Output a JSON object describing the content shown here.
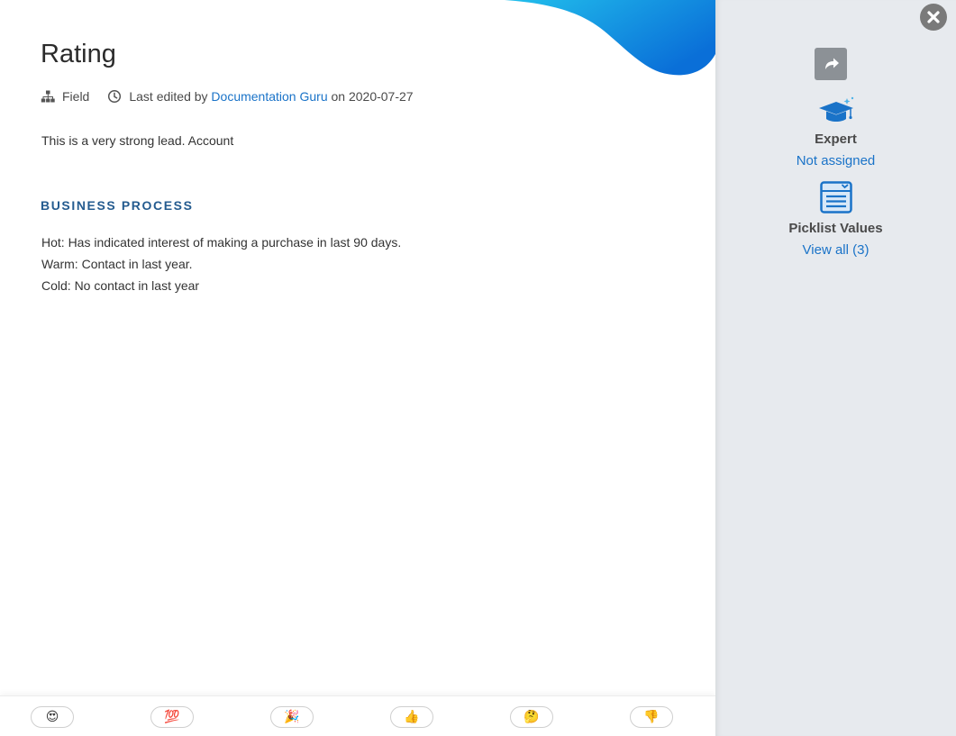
{
  "page": {
    "title": "Rating",
    "meta": {
      "type_label": "Field",
      "edited_prefix": "Last edited by",
      "editor": "Documentation Guru",
      "edited_on_word": "on",
      "edited_date": "2020-07-27"
    },
    "description": "This is a very strong lead. Account",
    "business_process": {
      "heading": "BUSINESS PROCESS",
      "lines": [
        "Hot: Has indicated interest of making a purchase in last 90 days.",
        "Warm: Contact in last year.",
        "Cold: No contact in last year"
      ]
    }
  },
  "reactions": [
    {
      "name": "heart-eyes",
      "emoji": "😍"
    },
    {
      "name": "hundred",
      "emoji": "💯"
    },
    {
      "name": "party-popper",
      "emoji": "🎉"
    },
    {
      "name": "thumbs-up",
      "emoji": "👍"
    },
    {
      "name": "thinking",
      "emoji": "🤔"
    },
    {
      "name": "thumbs-down",
      "emoji": "👎"
    }
  ],
  "sidebar": {
    "close_icon": "close-icon",
    "share_icon": "share-icon",
    "expert": {
      "icon": "graduation-cap-icon",
      "label": "Expert",
      "value": "Not assigned"
    },
    "picklist": {
      "icon": "list-icon",
      "label": "Picklist Values",
      "link": "View all (3)"
    }
  },
  "colors": {
    "accent_link": "#1a73c8",
    "heading_blue": "#245b8f",
    "sidebar_bg": "#e7eaee",
    "wave_start": "#18b4e8",
    "wave_end": "#0a6fd8"
  }
}
